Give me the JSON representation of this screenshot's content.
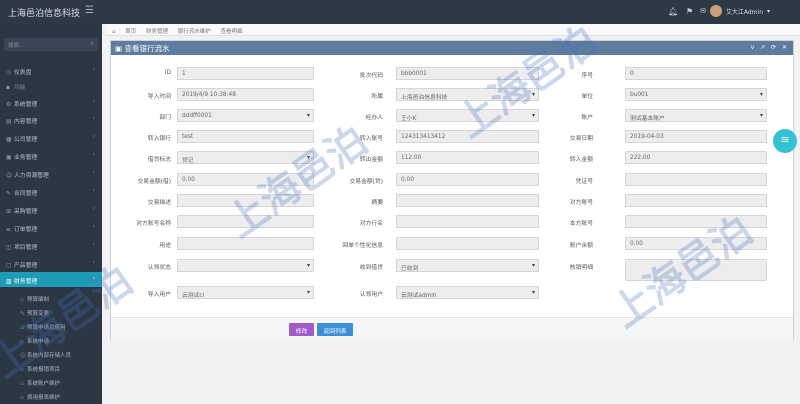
{
  "brand": "上海邑泊信息科技",
  "user": {
    "name": "艾大江Admin"
  },
  "sidebar": {
    "search_placeholder": "搜索...",
    "items": [
      {
        "label": "仪表盘"
      },
      {
        "label": "功能"
      },
      {
        "label": "系统管理"
      },
      {
        "label": "内容管理"
      },
      {
        "label": "公司管理"
      },
      {
        "label": "业务管理"
      },
      {
        "label": "人力资源管理"
      },
      {
        "label": "合同管理"
      },
      {
        "label": "采购管理"
      },
      {
        "label": "订单管理"
      },
      {
        "label": "项目管理"
      },
      {
        "label": "产品管理"
      },
      {
        "label": "财务管理"
      }
    ],
    "subitems": [
      {
        "label": "预算编制"
      },
      {
        "label": "预算变更"
      },
      {
        "label": "预算申请及使用"
      },
      {
        "label": "系统申请"
      },
      {
        "label": "系统内部存储人员"
      },
      {
        "label": "系统报销项目"
      },
      {
        "label": "系统账户维护"
      },
      {
        "label": "费用报表维护"
      }
    ]
  },
  "breadcrumb": [
    "首页",
    "财务管理",
    "银行流水维护",
    "查看明细"
  ],
  "panel": {
    "title": "查看银行流水",
    "tools": "v ↗ ⟳ ✕"
  },
  "form": {
    "fields": [
      {
        "label": "ID",
        "value": "1",
        "type": "text"
      },
      {
        "label": "批次代码",
        "value": "bbb0001",
        "type": "text"
      },
      {
        "label": "序号",
        "value": "0",
        "type": "text"
      },
      {
        "label": "导入时间",
        "value": "2019/4/9 10:38:48",
        "type": "text"
      },
      {
        "label": "所属",
        "value": "上海邑泊信息科技",
        "type": "select"
      },
      {
        "label": "单位",
        "value": "bu001",
        "type": "select"
      },
      {
        "label": "部门",
        "value": "dddff0001",
        "type": "select"
      },
      {
        "label": "经办人",
        "value": "王小K",
        "type": "select"
      },
      {
        "label": "账户",
        "value": "测试基本账户",
        "type": "select"
      },
      {
        "label": "转入银行",
        "value": "test",
        "type": "text"
      },
      {
        "label": "转入账号",
        "value": "124313413412",
        "type": "text"
      },
      {
        "label": "交易日期",
        "value": "2019-04-03",
        "type": "text"
      },
      {
        "label": "借贷标志",
        "value": "贷记",
        "type": "select"
      },
      {
        "label": "转出金额",
        "value": "112.00",
        "type": "text"
      },
      {
        "label": "转入金额",
        "value": "222.00",
        "type": "text"
      },
      {
        "label": "交易金额(借)",
        "value": "0.00",
        "type": "text"
      },
      {
        "label": "交易金额(贷)",
        "value": "0.00",
        "type": "text"
      },
      {
        "label": "凭证号",
        "value": "",
        "type": "text"
      },
      {
        "label": "交易描述",
        "value": "",
        "type": "text"
      },
      {
        "label": "摘要",
        "value": "",
        "type": "text"
      },
      {
        "label": "对方账号",
        "value": "",
        "type": "text"
      },
      {
        "label": "对方账号名称",
        "value": "",
        "type": "text"
      },
      {
        "label": "对方行名",
        "value": "",
        "type": "text"
      },
      {
        "label": "本方账号",
        "value": "",
        "type": "text"
      },
      {
        "label": "用途",
        "value": "",
        "type": "text"
      },
      {
        "label": "回单个性化信息",
        "value": "",
        "type": "text"
      },
      {
        "label": "账户余额",
        "value": "0.00",
        "type": "text"
      },
      {
        "label": "认领状态",
        "value": "",
        "type": "select"
      },
      {
        "label": "收到借贷",
        "value": "已收到",
        "type": "select"
      },
      {
        "label": "核销明细",
        "value": "",
        "type": "textarea"
      },
      {
        "label": "导入用户",
        "value": "云测试cl",
        "type": "select"
      },
      {
        "label": "认领用户",
        "value": "云测试admin",
        "type": "select"
      }
    ]
  },
  "buttons": {
    "edit": "修改",
    "back": "返回列表"
  },
  "watermark": "上海邑泊",
  "colors": {
    "active": "#1e9bb5",
    "panel_header": "#5e7c9e",
    "edit": "#a05bc8",
    "back": "#3b8fd6"
  }
}
